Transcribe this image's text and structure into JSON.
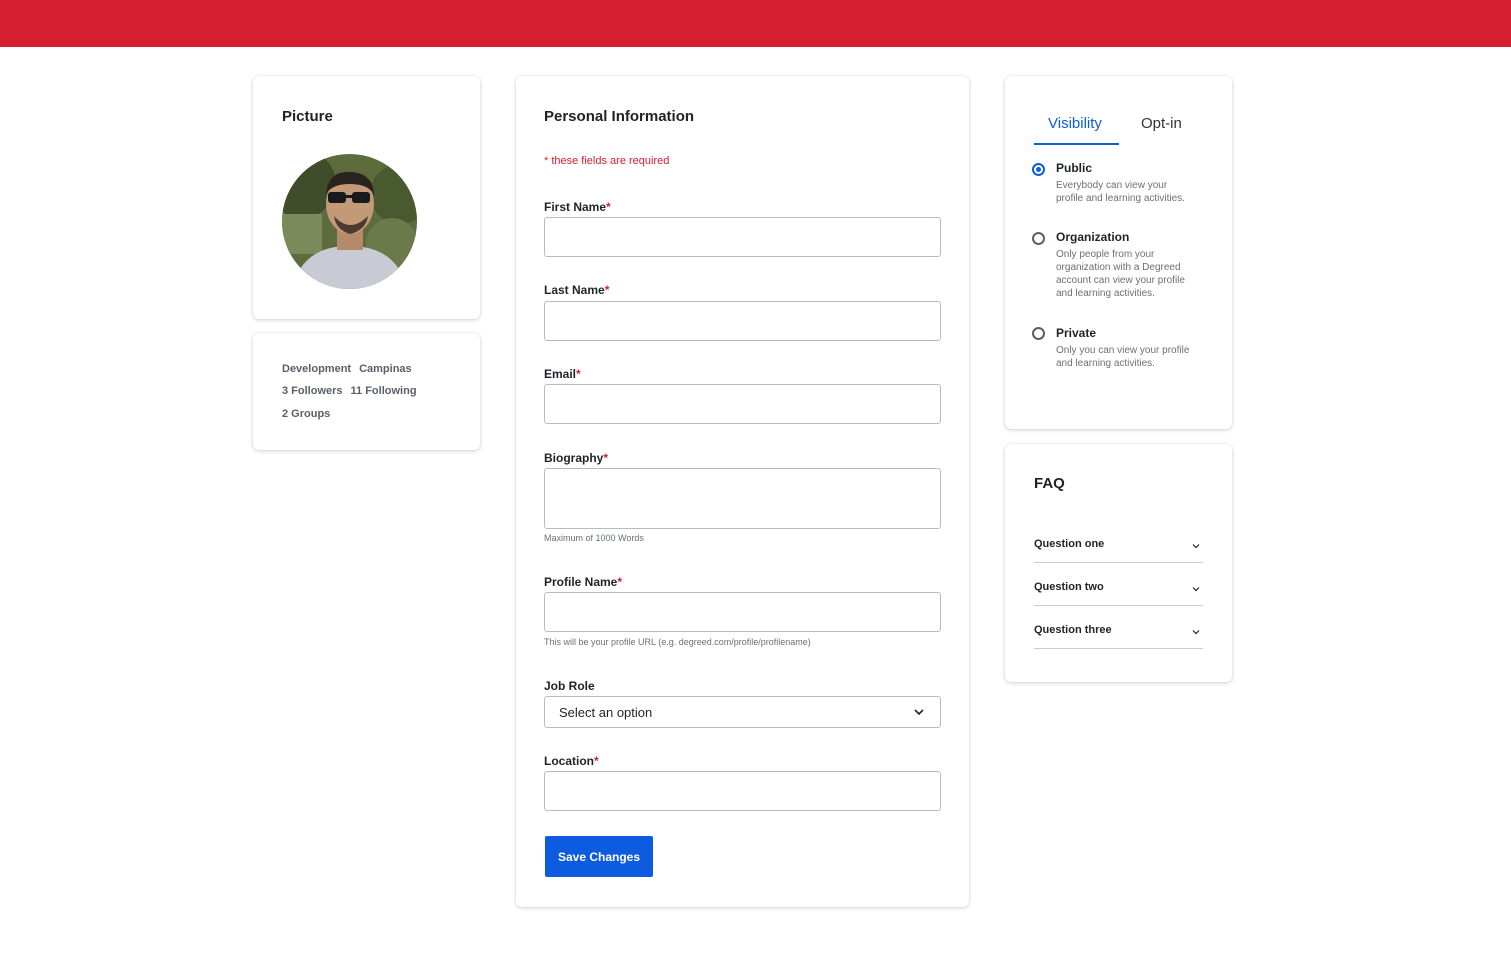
{
  "brand": {
    "topbar_color": "#d51f30",
    "accent": "#0d5ce0"
  },
  "picture_card": {
    "title": "Picture"
  },
  "stats": {
    "line1": [
      "Development",
      "Campinas"
    ],
    "line2": [
      "3 Followers",
      "11 Following"
    ],
    "line3": [
      "2 Groups"
    ]
  },
  "personal_info": {
    "title": "Personal Information",
    "required_note": "* these fields are required",
    "fields": {
      "first_name": {
        "label": "First Name",
        "value": ""
      },
      "last_name": {
        "label": "Last Name",
        "value": ""
      },
      "email": {
        "label": "Email",
        "value": ""
      },
      "biography": {
        "label": "Biography",
        "value": "",
        "hint": "Maximum of 1000 Words"
      },
      "profile_name": {
        "label": "Profile Name",
        "value": "",
        "hint": "This will be your profile URL (e.g. degreed.com/profile/profilename)"
      },
      "job_role": {
        "label": "Job Role",
        "selected": "Select an option"
      },
      "location": {
        "label": "Location",
        "value": ""
      }
    },
    "required_marker": "*",
    "save_label": "Save Changes"
  },
  "visibility": {
    "tabs": [
      "Visibility",
      "Opt-in"
    ],
    "options": [
      {
        "title": "Public",
        "desc": "Everybody can view your profile and learning activities.",
        "checked": true
      },
      {
        "title": "Organization",
        "desc": "Only people from your organization with a Degreed account can view your profile and learning activities.",
        "checked": false
      },
      {
        "title": "Private",
        "desc": "Only you can view your profile and learning activities.",
        "checked": false
      }
    ]
  },
  "faq": {
    "title": "FAQ",
    "items": [
      "Question one",
      "Question two",
      "Question three"
    ]
  }
}
